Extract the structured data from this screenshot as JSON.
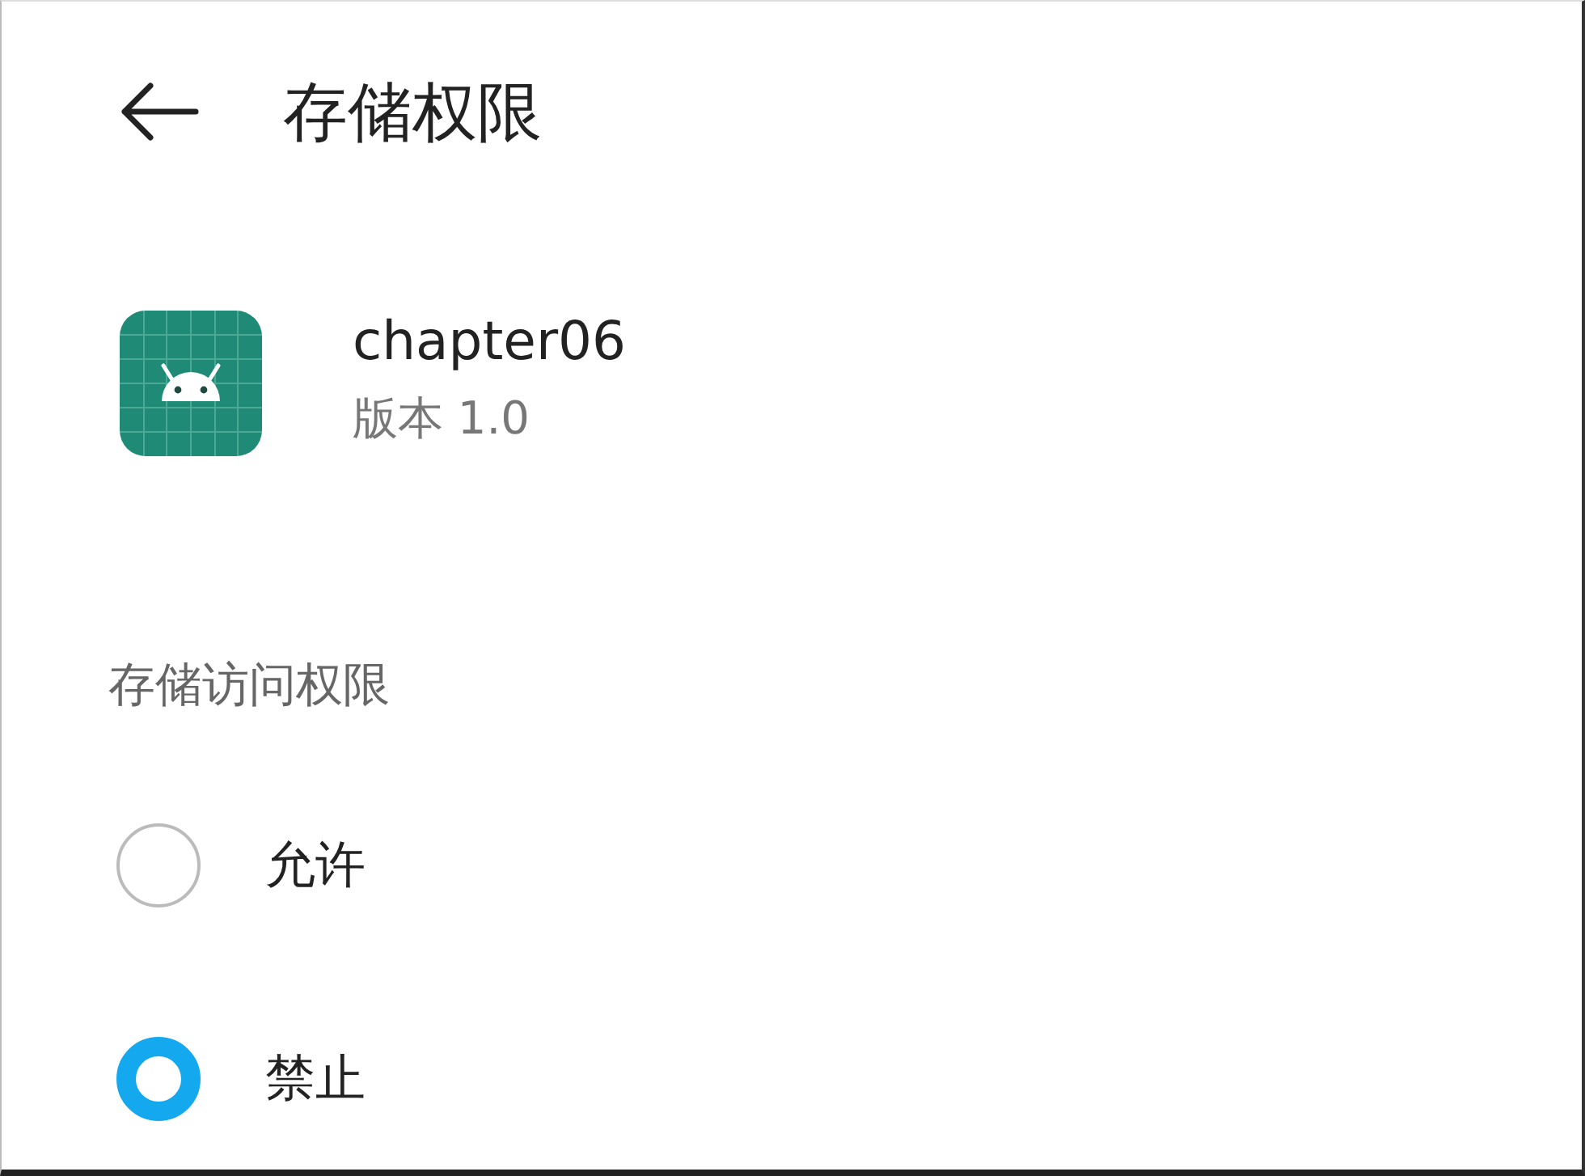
{
  "header": {
    "title": "存储权限"
  },
  "app": {
    "name": "chapter06",
    "version": "版本 1.0"
  },
  "section": {
    "title": "存储访问权限"
  },
  "options": [
    {
      "label": "允许",
      "selected": false
    },
    {
      "label": "禁止",
      "selected": true
    }
  ]
}
